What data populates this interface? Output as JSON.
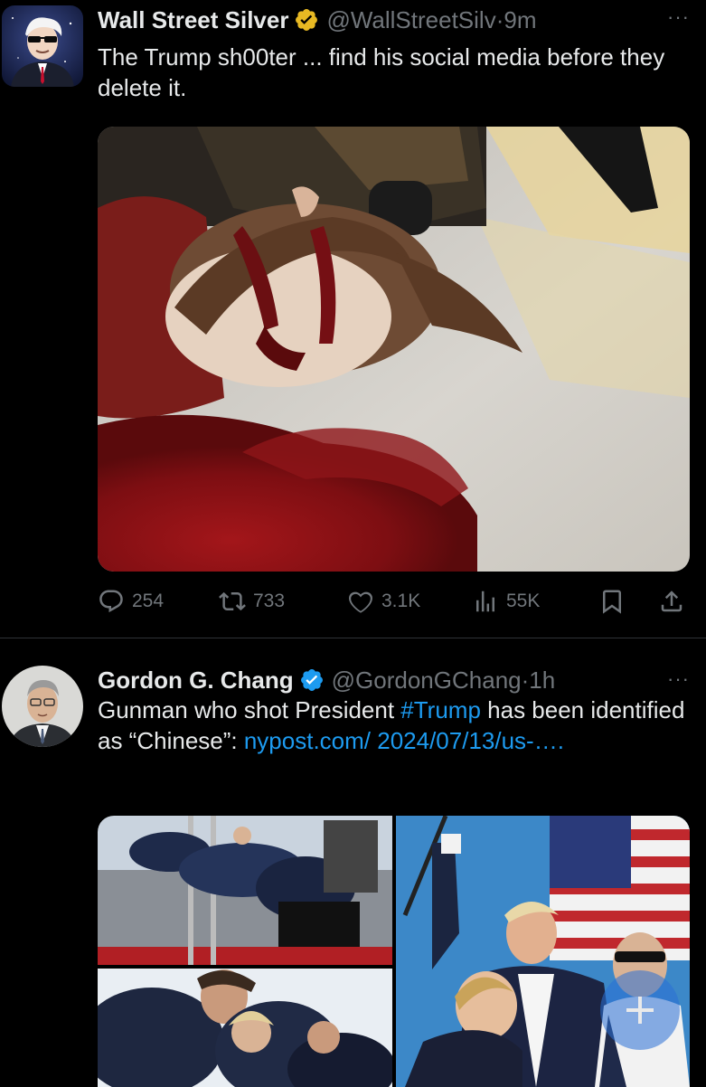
{
  "tweets": [
    {
      "author": "Wall Street Silver",
      "handle": "@WallStreetSilv",
      "time": "9m",
      "text": "The Trump sh00ter ... find his social media before they delete it.",
      "stats": {
        "replies": "254",
        "retweets": "733",
        "likes": "3.1K",
        "views": "55K"
      }
    },
    {
      "author": "Gordon G. Chang",
      "handle": "@GordonGChang",
      "time": "1h",
      "text_before": "Gunman who shot President ",
      "hashtag": "#Trump",
      "text_after": " has been identified as “Chinese”: ",
      "link": "nypost.com/ 2024/07/13/us-…."
    }
  ],
  "separator": "·",
  "more_glyph": "···",
  "colors": {
    "background": "#000000",
    "text": "#e7e9ea",
    "muted": "#71767b",
    "link": "#1d9bf0",
    "verified_gold": "#e8b923",
    "verified_blue": "#1d9bf0"
  },
  "icons": [
    "verified-badge-icon",
    "reply-icon",
    "retweet-icon",
    "like-icon",
    "views-icon",
    "bookmark-icon",
    "share-icon",
    "more-icon"
  ]
}
